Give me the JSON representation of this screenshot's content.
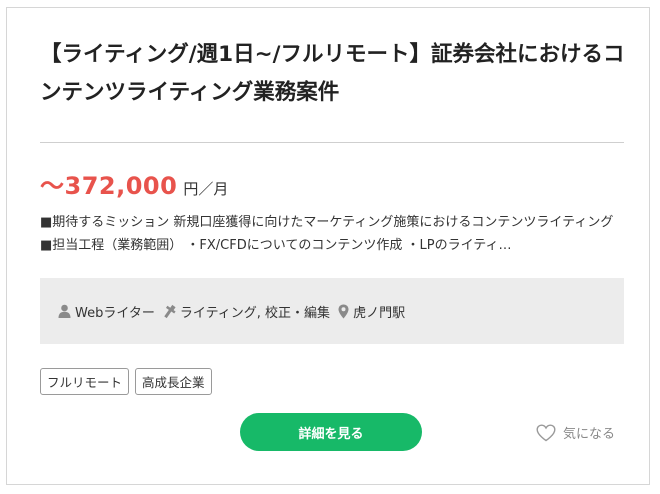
{
  "job": {
    "title": "【ライティング/週1日~/フルリモート】証券会社におけるコンテンツライティング業務案件",
    "salary_amount": "〜372,000",
    "salary_unit": "円／月",
    "description": "■期待するミッション 新規口座獲得に向けたマーケティング施策におけるコンテンツライティング ■担当工程（業務範囲） ・FX/CFDについてのコンテンツ作成 ・LPのライティ…",
    "info": {
      "role": "Webライター",
      "skills": "ライティング, 校正・編集",
      "station": "虎ノ門駅"
    },
    "tags": [
      "フルリモート",
      "高成長企業"
    ],
    "detail_button_label": "詳細を見る",
    "favorite_label": "気になる"
  },
  "colors": {
    "salary": "#e8534c",
    "button": "#17b968",
    "info_bg": "#ececec"
  },
  "icons": [
    "person-icon",
    "wrench-icon",
    "location-pin-icon",
    "heart-icon"
  ]
}
